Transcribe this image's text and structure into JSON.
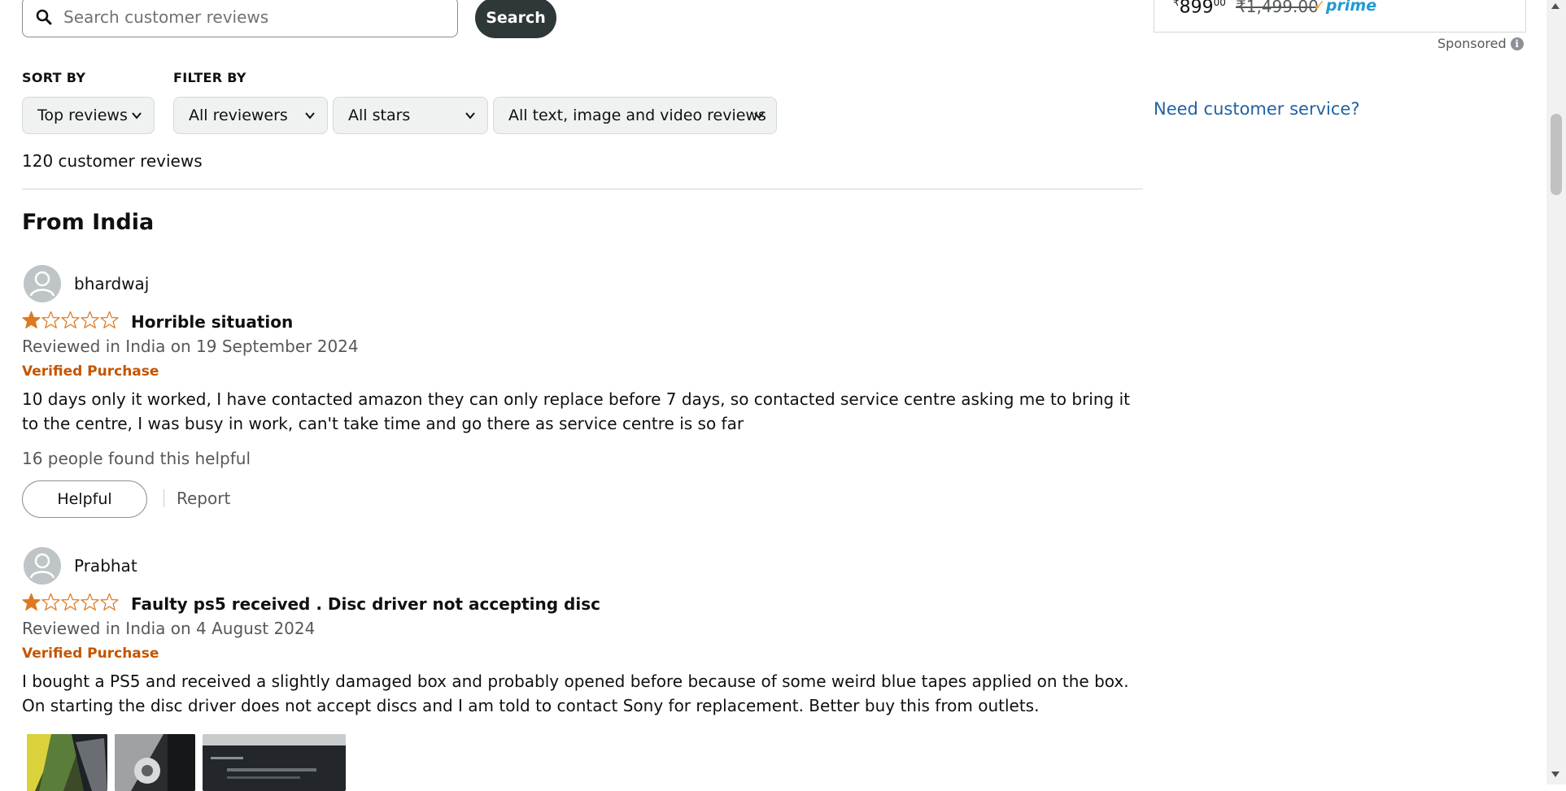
{
  "search": {
    "placeholder": "Search customer reviews",
    "button_label": "Search"
  },
  "sort": {
    "label": "SORT BY",
    "selected": "Top reviews"
  },
  "filter": {
    "label": "FILTER BY",
    "reviewers": "All reviewers",
    "stars": "All stars",
    "media": "All text, image and video reviews"
  },
  "review_count": "120 customer reviews",
  "section_title": "From India",
  "reviews": [
    {
      "author": "bhardwaj",
      "rating": 1,
      "title": "Horrible situation",
      "meta": "Reviewed in India on 19 September 2024",
      "verified": "Verified Purchase",
      "body": "10 days only it worked, I have contacted amazon they can only replace before 7 days, so contacted service centre asking me to bring it to the centre, I was busy in work, can't take time and go there as service centre is so far",
      "helpful_count": "16 people found this helpful",
      "helpful_label": "Helpful",
      "report_label": "Report"
    },
    {
      "author": "Prabhat",
      "rating": 1,
      "title": "Faulty ps5 received . Disc driver not accepting disc",
      "meta": "Reviewed in India on 4 August 2024",
      "verified": "Verified Purchase",
      "body": "I bought a PS5 and received a slightly damaged box and probably opened before because of some weird blue tapes applied on the box. On starting the disc driver does not accept discs and I am told to contact Sony for replacement. Better buy this from outlets."
    }
  ],
  "sidebar": {
    "price_symbol": "₹",
    "price_whole": "899",
    "price_fraction": "00",
    "strike_price": "₹1,499.00",
    "prime_label": "prime",
    "sponsored": "Sponsored",
    "info_glyph": "i",
    "customer_service": "Need customer service?"
  },
  "colors": {
    "star": "#de7921",
    "verified": "#c45500",
    "link": "#2162a1",
    "search_button": "#2f3838"
  },
  "icons": {
    "search": "magnifier",
    "chevron": "chevron-down",
    "avatar": "person-silhouette",
    "star_filled": "star-filled",
    "star_empty": "star-outline"
  }
}
